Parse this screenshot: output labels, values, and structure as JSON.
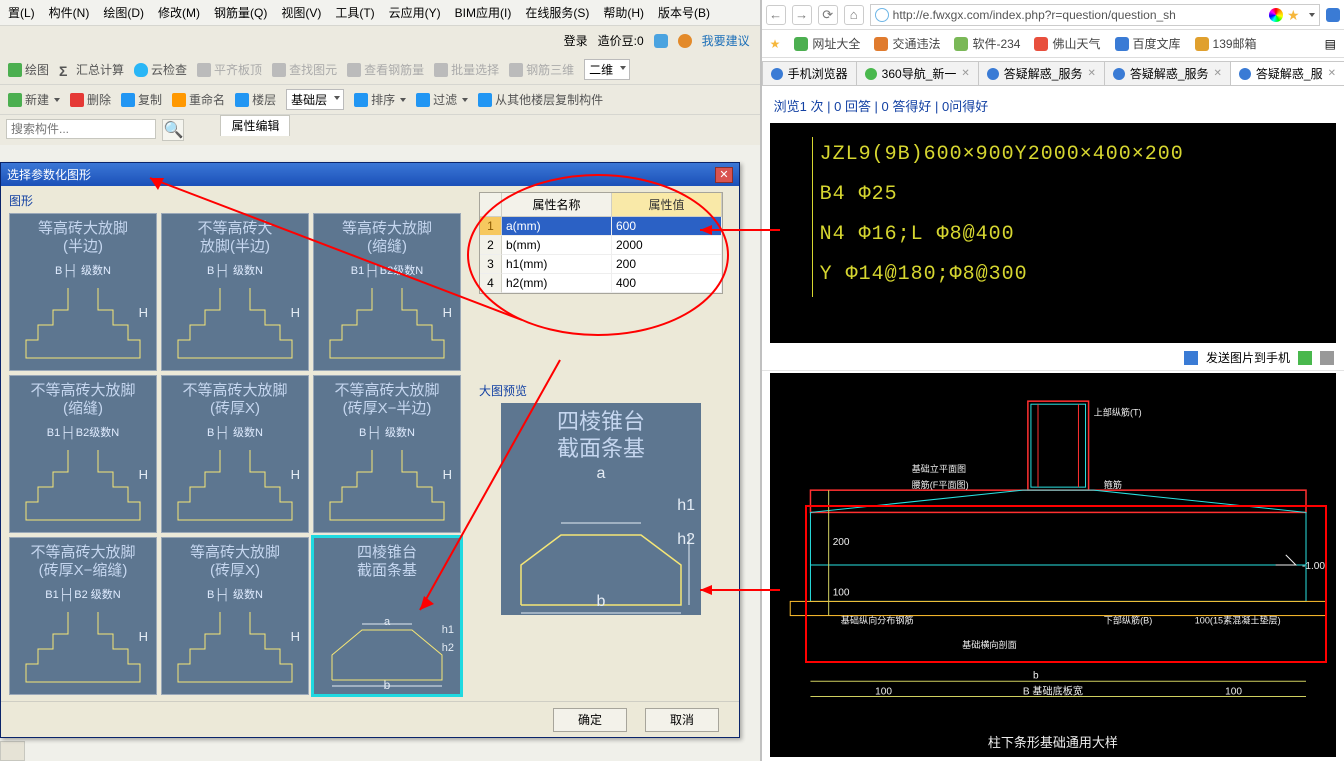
{
  "menu": {
    "items": [
      "置(L)",
      "构件(N)",
      "绘图(D)",
      "修改(M)",
      "钢筋量(Q)",
      "视图(V)",
      "工具(T)",
      "云应用(Y)",
      "BIM应用(I)",
      "在线服务(S)",
      "帮助(H)",
      "版本号(B)"
    ]
  },
  "top_right": {
    "login": "登录",
    "price": "造价豆:0",
    "suggest": "我要建议"
  },
  "toolbar1": {
    "draw": "绘图",
    "sigma": "Σ",
    "sum": "汇总计算",
    "cloud": "云检查",
    "flat": "平齐板顶",
    "find": "查找图元",
    "view_rebar": "查看钢筋量",
    "batch_sel": "批量选择",
    "rebar3d": "钢筋三维",
    "combo": "二维"
  },
  "toolbar2": {
    "new": "新建",
    "del": "删除",
    "copy": "复制",
    "rename": "重命名",
    "floor": "楼层",
    "base_layer": "基础层",
    "sort": "排序",
    "filter": "过滤",
    "copy_floor": "从其他楼层复制构件"
  },
  "search": {
    "placeholder": "搜索构件..."
  },
  "prop_tab": "属性编辑",
  "dialog": {
    "title": "选择参数化图形",
    "section_shape": "图形",
    "shapes": [
      {
        "t1": "等高砖大放脚",
        "t2": "(半边)",
        "p": "B├┤ 级数N"
      },
      {
        "t1": "不等高砖大",
        "t2": "放脚(半边)",
        "p": "B├┤ 级数N"
      },
      {
        "t1": "等高砖大放脚",
        "t2": "(缩缝)",
        "p": "B1├┤B2级数N"
      },
      {
        "t1": "不等高砖大放脚",
        "t2": "(缩缝)",
        "p": "B1├┤B2级数N"
      },
      {
        "t1": "不等高砖大放脚",
        "t2": "(砖厚X)",
        "p": "B├┤ 级数N"
      },
      {
        "t1": "不等高砖大放脚",
        "t2": "(砖厚X−半边)",
        "p": "B├┤ 级数N"
      },
      {
        "t1": "不等高砖大放脚",
        "t2": "(砖厚X−缩缝)",
        "p": "B1├┤B2 级数N"
      },
      {
        "t1": "等高砖大放脚",
        "t2": "(砖厚X)",
        "p": "B├┤ 级数N"
      },
      {
        "t1": "四棱锥台",
        "t2": "截面条基",
        "p": ""
      }
    ],
    "selected_index": 8,
    "param_header_name": "属性名称",
    "param_header_val": "属性值",
    "rows": [
      {
        "n": "a(mm)",
        "v": "600",
        "sel": true
      },
      {
        "n": "b(mm)",
        "v": "2000"
      },
      {
        "n": "h1(mm)",
        "v": "200"
      },
      {
        "n": "h2(mm)",
        "v": "400"
      }
    ],
    "preview_label": "大图预览",
    "preview_title1": "四棱锥台",
    "preview_title2": "截面条基",
    "preview_a": "a",
    "preview_b": "b",
    "preview_h1": "h1",
    "preview_h2": "h2",
    "ok": "确定",
    "cancel": "取消"
  },
  "browser": {
    "url": "http://e.fwxgx.com/index.php?r=question/question_sh",
    "bookmarks": [
      {
        "label": "网址大全",
        "color": "#4caf50"
      },
      {
        "label": "交通违法",
        "color": "#e07b2e"
      },
      {
        "label": "软件-234",
        "color": "#7ab857"
      },
      {
        "label": "佛山天气",
        "color": "#e84f3d"
      },
      {
        "label": "百度文库",
        "color": "#3a7bd5"
      },
      {
        "label": "139邮箱",
        "color": "#e0a02e"
      }
    ],
    "tabs": [
      {
        "label": "手机浏览器",
        "fav": "#3a7bd5",
        "active": false
      },
      {
        "label": "360导航_新一",
        "fav": "#49b84d",
        "active": false,
        "closable": true
      },
      {
        "label": "答疑解惑_服务",
        "fav": "#3a7bd5",
        "active": false,
        "closable": true
      },
      {
        "label": "答疑解惑_服务",
        "fav": "#3a7bd5",
        "active": false,
        "closable": true
      },
      {
        "label": "答疑解惑_服",
        "fav": "#3a7bd5",
        "active": true,
        "closable": true
      }
    ],
    "stats": "浏览1 次 | 0 回答 | 0 答得好 | 0问得好",
    "cad": {
      "l1": "JZL9(9B)600×900Y2000×400×200",
      "l2": "B4 Φ25",
      "l3": "N4 Φ16;L Φ8@400",
      "l4": "Y Φ14@180;Φ8@300"
    },
    "send_to_phone": "发送图片到手机",
    "drawing_caption": "柱下条形基础通用大样",
    "elev": "-1.00",
    "dim200": "200",
    "dim100a": "100",
    "dim100b": "100(15素混凝土垫层)",
    "dimB_label": "B 基础底板宽",
    "dim_b_small": "b",
    "dim100L": "100",
    "dim100R": "100",
    "label_topbar": "上部纵筋(T)",
    "label_waist": "基础立平面图",
    "label_waist2": "腰筋(F平面图)",
    "label_stirrup": "箍筋",
    "label_left_bot": "基础纵向分布钢筋",
    "label_bot_bar": "下部纵筋(B)",
    "label_base_sec": "基础横向剖面"
  }
}
